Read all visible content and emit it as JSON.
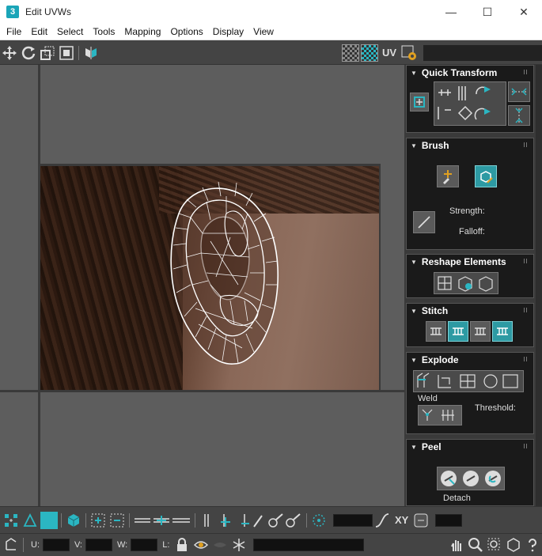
{
  "window": {
    "app_icon": "3",
    "title": "Edit UVWs"
  },
  "window_controls": {
    "minimize": "—",
    "maximize": "☐",
    "close": "✕"
  },
  "menu": [
    "File",
    "Edit",
    "Select",
    "Tools",
    "Mapping",
    "Options",
    "Display",
    "View"
  ],
  "toolbar": {
    "uv_label": "UV"
  },
  "rollouts": {
    "quick_transform": {
      "title": "Quick Transform"
    },
    "brush": {
      "title": "Brush",
      "strength_label": "Strength:",
      "falloff_label": "Falloff:"
    },
    "reshape": {
      "title": "Reshape Elements"
    },
    "stitch": {
      "title": "Stitch"
    },
    "explode": {
      "title": "Explode",
      "weld_label": "Weld",
      "threshold_label": "Threshold:"
    },
    "peel": {
      "title": "Peel",
      "detach_label": "Detach"
    }
  },
  "bottom": {
    "xy_label": "XY",
    "u_label": "U:",
    "v_label": "V:",
    "w_label": "W:",
    "l_label": "L:"
  },
  "colors": {
    "accent": "#2bb6c2",
    "panel_bg": "#1a1a1a",
    "viewport_bg": "#5d5d5d"
  }
}
